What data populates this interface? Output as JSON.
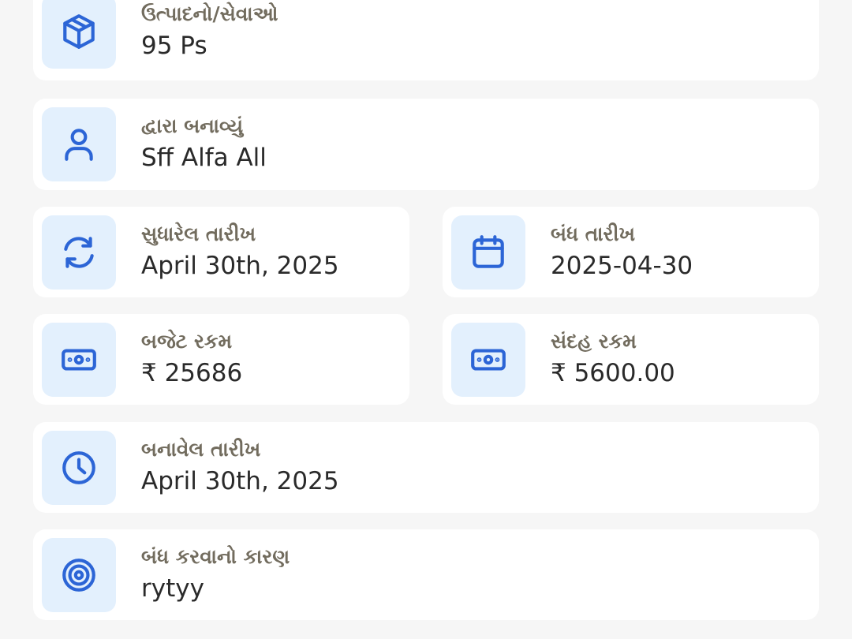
{
  "colors": {
    "background": "#f6f6f6",
    "card": "#ffffff",
    "icon_bg": "#e3f0fd",
    "icon": "#2c65d6",
    "label": "#726c5e",
    "value": "#2a2a2a"
  },
  "fields": {
    "products": {
      "label": "ઉત્પાદનો/સેવાઓ",
      "value": "95 Ps",
      "icon": "cube-icon"
    },
    "created_by": {
      "label": "દ્વારા બનાવ્યું",
      "value": "Sff Alfa All",
      "icon": "user-icon"
    },
    "modified_date": {
      "label": "સુધારેલ તારીખ",
      "value": "April 30th, 2025",
      "icon": "refresh-icon"
    },
    "close_date": {
      "label": "બંધ તારીખ",
      "value": "2025-04-30",
      "icon": "calendar-icon"
    },
    "budget_amount": {
      "label": "બજેટ રકમ",
      "value": "₹ 25686",
      "icon": "banknote-icon"
    },
    "doubt_amount": {
      "label": "સંદહ રકમ",
      "value": "₹ 5600.00",
      "icon": "banknote-icon"
    },
    "created_date": {
      "label": "બનાવેલ તારીખ",
      "value": "April 30th, 2025",
      "icon": "clock-icon"
    },
    "close_reason": {
      "label": "બંધ કરવાનો કારણ",
      "value": "rytyy",
      "icon": "target-icon"
    }
  }
}
